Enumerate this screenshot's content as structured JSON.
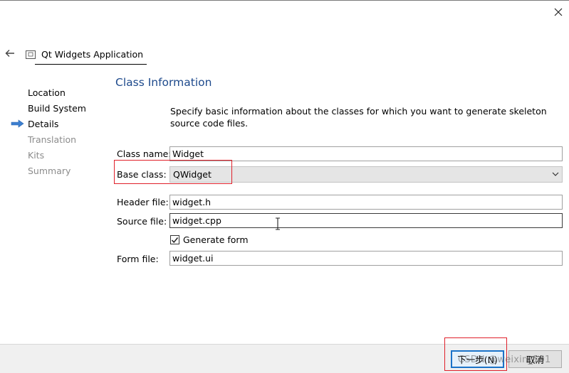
{
  "window": {
    "close_icon": "close-icon"
  },
  "wizard": {
    "title": "Qt Widgets Application",
    "back_icon": "back-arrow-icon",
    "title_icon": "app-window-icon"
  },
  "steps": [
    {
      "label": "Location",
      "state": "done"
    },
    {
      "label": "Build System",
      "state": "done"
    },
    {
      "label": "Details",
      "state": "current"
    },
    {
      "label": "Translation",
      "state": "pending"
    },
    {
      "label": "Kits",
      "state": "pending"
    },
    {
      "label": "Summary",
      "state": "pending"
    }
  ],
  "page": {
    "heading": "Class Information",
    "description": "Specify basic information about the classes for which you want to generate skeleton source code files."
  },
  "form": {
    "class_name_label": "Class name:",
    "class_name_value": "Widget",
    "base_class_label": "Base class:",
    "base_class_value": "QWidget",
    "header_file_label": "Header file:",
    "header_file_value": "widget.h",
    "source_file_label": "Source file:",
    "source_file_value": "widget.cpp",
    "generate_form_label": "Generate form",
    "generate_form_checked": true,
    "form_file_label": "Form file:",
    "form_file_value": "widget.ui"
  },
  "footer": {
    "next_label": "下一步(N)",
    "cancel_label": "取消"
  },
  "watermark": "CSDN @weixin_101",
  "colors": {
    "heading": "#1e4a8c",
    "highlight": "#e0202a",
    "arrow": "#3c7fd0",
    "disabled_text": "#8c8c8c"
  }
}
